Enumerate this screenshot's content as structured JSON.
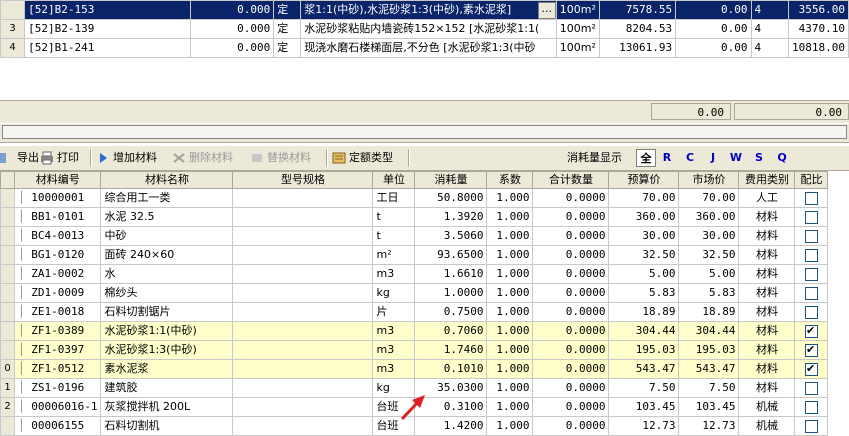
{
  "top_grid": {
    "rows": [
      {
        "idx": "",
        "code": "[52]B2-153",
        "qty": "0.000",
        "type": "定",
        "name": "浆1:1(中砂),水泥砂浆1:3(中砂),素水泥浆]",
        "more": "...",
        "unit": "100m²",
        "price": "7578.55",
        "val": "0.00",
        "n": "4",
        "total": "3556.00"
      },
      {
        "idx": "3",
        "code": "[52]B2-139",
        "qty": "0.000",
        "type": "定",
        "name": "水泥砂浆粘贴内墙瓷砖152×152 [水泥砂浆1:1(",
        "more": "",
        "unit": "100m²",
        "price": "8204.53",
        "val": "0.00",
        "n": "4",
        "total": "4370.10"
      },
      {
        "idx": "4",
        "code": "[52]B1-241",
        "qty": "0.000",
        "type": "定",
        "name": "现浇水磨石楼梯面层,不分色 [水泥砂浆1:3(中砂",
        "more": "",
        "unit": "100m²",
        "price": "13061.93",
        "val": "0.00",
        "n": "4",
        "total": "10818.00"
      }
    ]
  },
  "summary": {
    "value1": "0.00",
    "value2": "0.00"
  },
  "toolbar": {
    "export_label": "导出",
    "print_label": "打印",
    "add_label": "增加材料",
    "delete_label": "删除材料",
    "replace_label": "替换材料",
    "quota_type_label": "定额类型",
    "consumption_display_label": "消耗量显示",
    "filters": [
      "全",
      "R",
      "C",
      "J",
      "W",
      "S",
      "Q"
    ]
  },
  "columns": [
    "材料编号",
    "材料名称",
    "型号规格",
    "单位",
    "消耗量",
    "系数",
    "合计数量",
    "预算价",
    "市场价",
    "费用类别",
    "配比"
  ],
  "rows": [
    {
      "idx": "",
      "code": "10000001",
      "name": "综合用工一类",
      "spec": "",
      "unit": "工日",
      "qty": "50.8000",
      "coef": "1.000",
      "total": "0.0000",
      "budget": "70.00",
      "market": "70.00",
      "cat": "人工",
      "ratio": false,
      "hl": false
    },
    {
      "idx": "",
      "code": "BB1-0101",
      "name": "水泥 32.5",
      "spec": "",
      "unit": "t",
      "qty": "1.3920",
      "coef": "1.000",
      "total": "0.0000",
      "budget": "360.00",
      "market": "360.00",
      "cat": "材料",
      "ratio": false,
      "hl": false
    },
    {
      "idx": "",
      "code": "BC4-0013",
      "name": "中砂",
      "spec": "",
      "unit": "t",
      "qty": "3.5060",
      "coef": "1.000",
      "total": "0.0000",
      "budget": "30.00",
      "market": "30.00",
      "cat": "材料",
      "ratio": false,
      "hl": false
    },
    {
      "idx": "",
      "code": "BG1-0120",
      "name": "面砖 240×60",
      "spec": "",
      "unit": "m²",
      "qty": "93.6500",
      "coef": "1.000",
      "total": "0.0000",
      "budget": "32.50",
      "market": "32.50",
      "cat": "材料",
      "ratio": false,
      "hl": false
    },
    {
      "idx": "",
      "code": "ZA1-0002",
      "name": "水",
      "spec": "",
      "unit": "m3",
      "qty": "1.6610",
      "coef": "1.000",
      "total": "0.0000",
      "budget": "5.00",
      "market": "5.00",
      "cat": "材料",
      "ratio": false,
      "hl": false
    },
    {
      "idx": "",
      "code": "ZD1-0009",
      "name": "棉纱头",
      "spec": "",
      "unit": "kg",
      "qty": "1.0000",
      "coef": "1.000",
      "total": "0.0000",
      "budget": "5.83",
      "market": "5.83",
      "cat": "材料",
      "ratio": false,
      "hl": false
    },
    {
      "idx": "",
      "code": "ZE1-0018",
      "name": "石料切割锯片",
      "spec": "",
      "unit": "片",
      "qty": "0.7500",
      "coef": "1.000",
      "total": "0.0000",
      "budget": "18.89",
      "market": "18.89",
      "cat": "材料",
      "ratio": false,
      "hl": false
    },
    {
      "idx": "",
      "code": "ZF1-0389",
      "name": "水泥砂浆1:1(中砂)",
      "spec": "",
      "unit": "m3",
      "qty": "0.7060",
      "coef": "1.000",
      "total": "0.0000",
      "budget": "304.44",
      "market": "304.44",
      "cat": "材料",
      "ratio": true,
      "hl": true
    },
    {
      "idx": "",
      "code": "ZF1-0397",
      "name": "水泥砂浆1:3(中砂)",
      "spec": "",
      "unit": "m3",
      "qty": "1.7460",
      "coef": "1.000",
      "total": "0.0000",
      "budget": "195.03",
      "market": "195.03",
      "cat": "材料",
      "ratio": true,
      "hl": true
    },
    {
      "idx": "0",
      "code": "ZF1-0512",
      "name": "素水泥浆",
      "spec": "",
      "unit": "m3",
      "qty": "0.1010",
      "coef": "1.000",
      "total": "0.0000",
      "budget": "543.47",
      "market": "543.47",
      "cat": "材料",
      "ratio": true,
      "hl": true
    },
    {
      "idx": "1",
      "code": "ZS1-0196",
      "name": "建筑胶",
      "spec": "",
      "unit": "kg",
      "qty": "35.0300",
      "coef": "1.000",
      "total": "0.0000",
      "budget": "7.50",
      "market": "7.50",
      "cat": "材料",
      "ratio": false,
      "hl": false
    },
    {
      "idx": "2",
      "code": "00006016-1",
      "name": "灰浆搅拌机 200L",
      "spec": "",
      "unit": "台班",
      "qty": "0.3100",
      "coef": "1.000",
      "total": "0.0000",
      "budget": "103.45",
      "market": "103.45",
      "cat": "机械",
      "ratio": false,
      "hl": false
    },
    {
      "idx": "",
      "code": "00006155",
      "name": "石料切割机",
      "spec": "",
      "unit": "台班",
      "qty": "1.4200",
      "coef": "1.000",
      "total": "0.0000",
      "budget": "12.73",
      "market": "12.73",
      "cat": "机械",
      "ratio": false,
      "hl": false
    }
  ],
  "colors": {
    "selection": "#0a246a",
    "highlight": "#ffffcc",
    "chrome": "#ece9d8",
    "arrow": "#e02020"
  }
}
